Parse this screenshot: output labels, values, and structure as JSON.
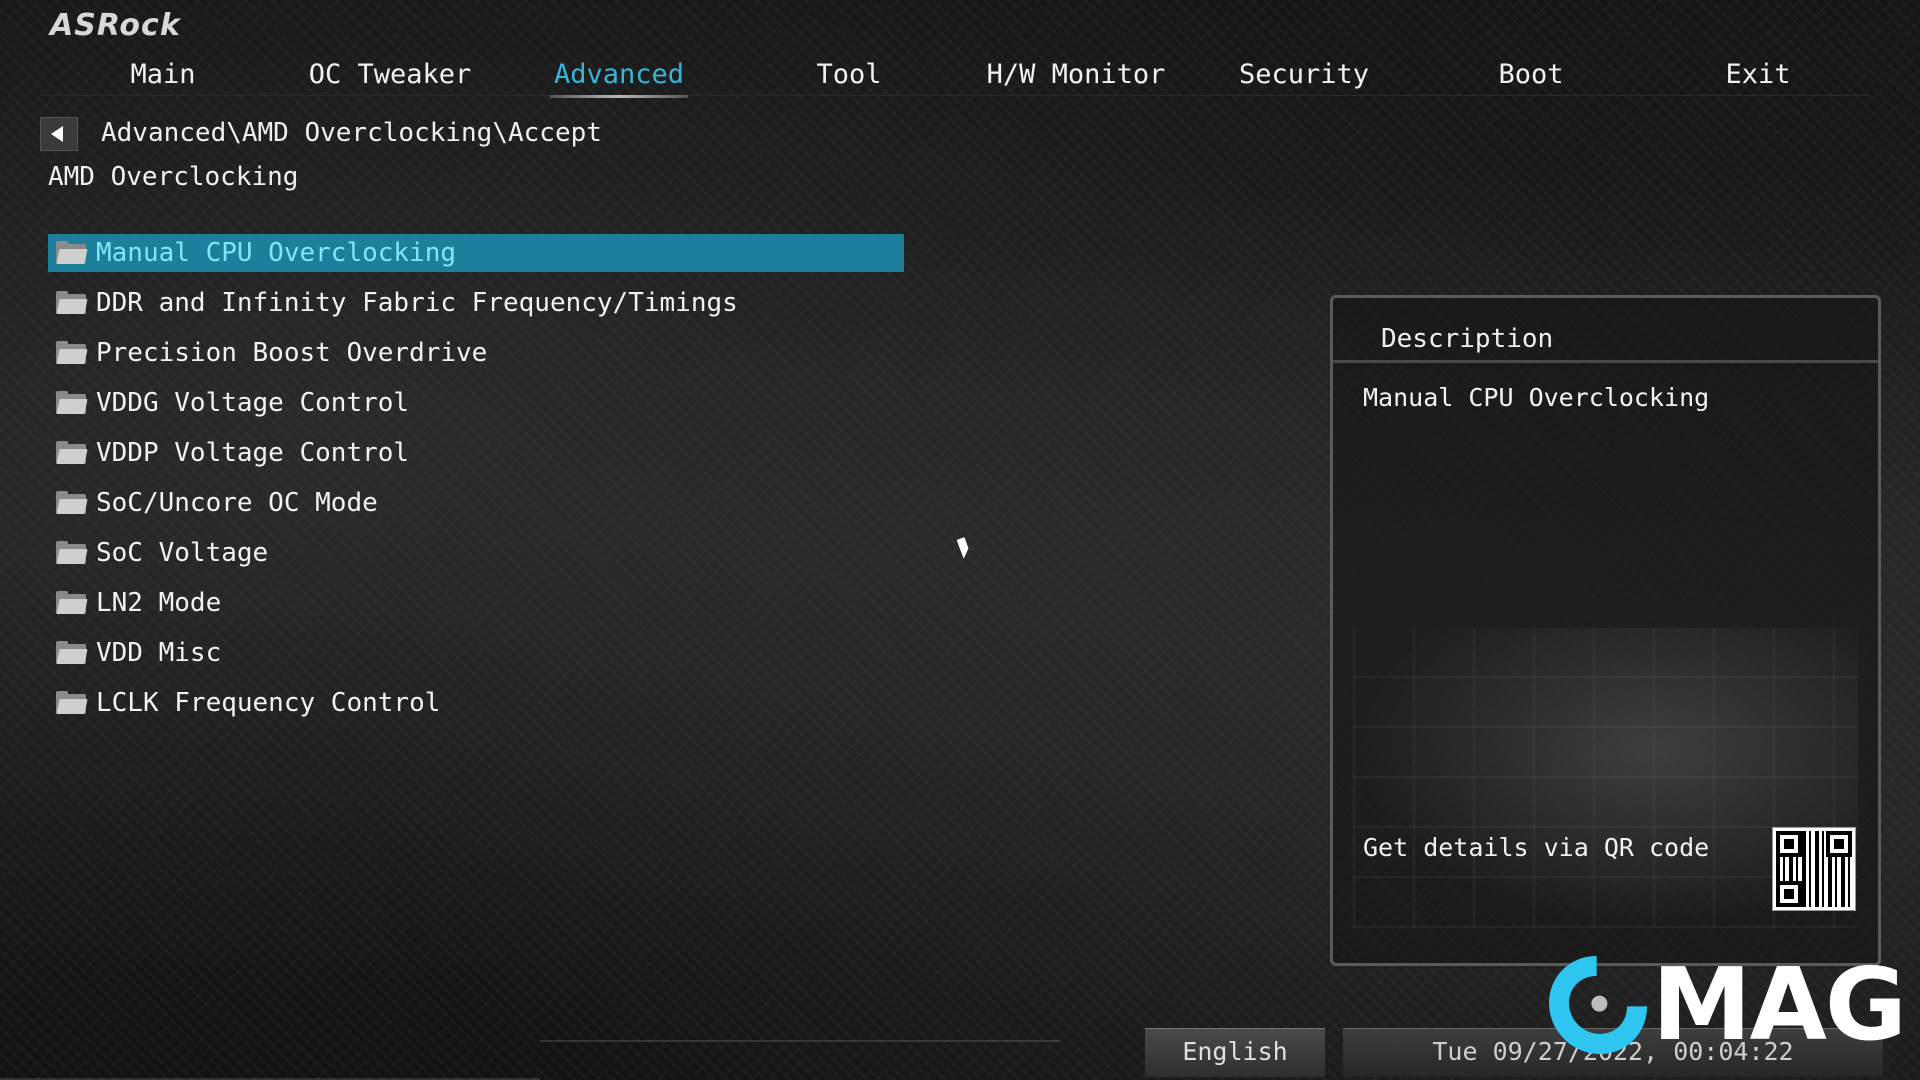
{
  "brand": {
    "logo_text": "ASRock"
  },
  "nav": {
    "tabs": [
      {
        "label": "Main"
      },
      {
        "label": "OC Tweaker"
      },
      {
        "label": "Advanced",
        "active": true
      },
      {
        "label": "Tool"
      },
      {
        "label": "H/W Monitor"
      },
      {
        "label": "Security"
      },
      {
        "label": "Boot"
      },
      {
        "label": "Exit"
      }
    ]
  },
  "breadcrumb": {
    "path": "Advanced\\AMD Overclocking\\Accept"
  },
  "page": {
    "title": "AMD Overclocking"
  },
  "menu": {
    "items": [
      {
        "label": "Manual CPU Overclocking",
        "selected": true
      },
      {
        "label": "DDR and Infinity Fabric Frequency/Timings"
      },
      {
        "label": "Precision Boost Overdrive"
      },
      {
        "label": "VDDG Voltage Control"
      },
      {
        "label": "VDDP Voltage Control"
      },
      {
        "label": "SoC/Uncore OC Mode"
      },
      {
        "label": "SoC Voltage"
      },
      {
        "label": "LN2 Mode"
      },
      {
        "label": "VDD Misc"
      },
      {
        "label": "LCLK Frequency Control"
      }
    ]
  },
  "description": {
    "title": "Description",
    "text": "Manual CPU Overclocking",
    "qr_label": "Get details via QR code"
  },
  "footer": {
    "language": "English",
    "datetime": "Tue 09/27/2022, 00:04:22"
  },
  "watermark": {
    "text": "MAG"
  },
  "colors": {
    "accent": "#39b4d8",
    "selected_row": "#1d7f9c",
    "selected_text": "#7fe6ff",
    "watermark_c": "#2ec6f0"
  }
}
